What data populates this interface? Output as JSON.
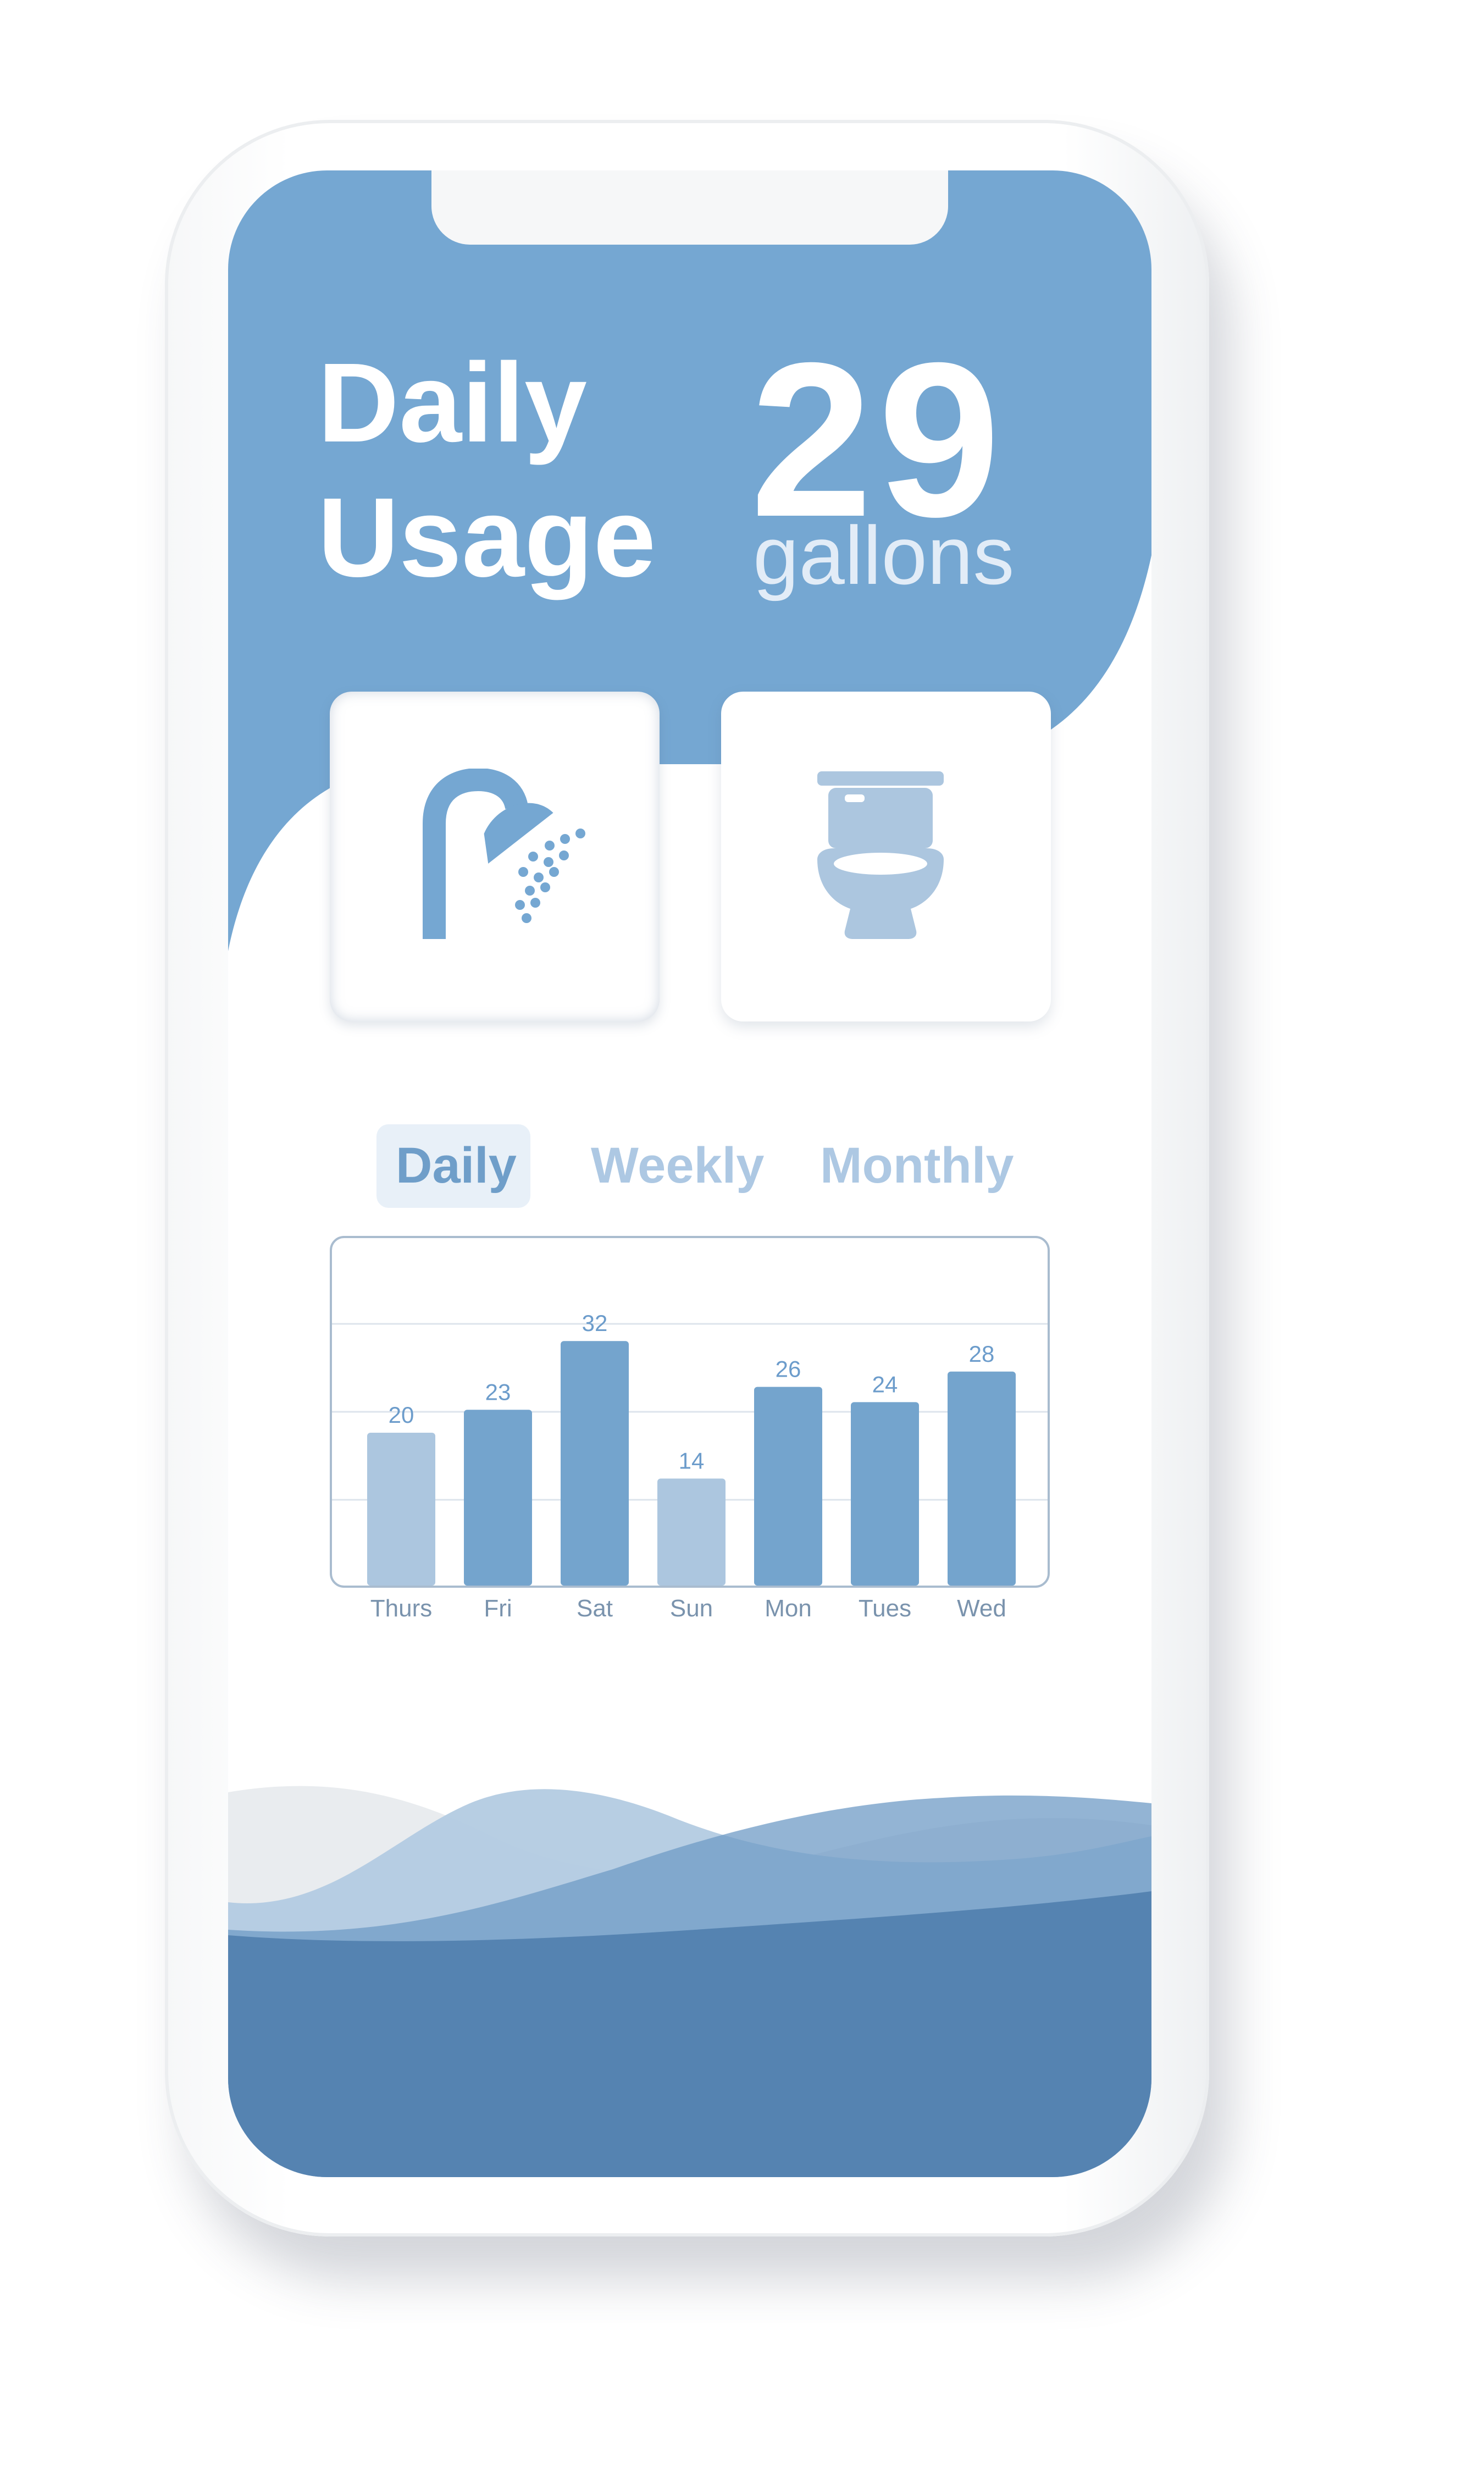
{
  "header": {
    "title_line1": "Daily",
    "title_line2": "Usage",
    "amount": "29",
    "unit": "gallons"
  },
  "cards": [
    {
      "icon": "shower-icon",
      "selected": true
    },
    {
      "icon": "toilet-icon",
      "selected": false
    }
  ],
  "tabs": [
    {
      "label": "Daily",
      "active": true
    },
    {
      "label": "Weekly",
      "active": false
    },
    {
      "label": "Monthly",
      "active": false
    }
  ],
  "colors": {
    "primary": "#75a7d2",
    "bar_dark": "#74a4cd",
    "bar_light": "#acc6df",
    "wave_dark": "#5583b1",
    "tab_active": "#6f9ec9",
    "tab_inactive": "#adc8e3"
  },
  "chart_data": {
    "type": "bar",
    "categories": [
      "Thurs",
      "Fri",
      "Sat",
      "Sun",
      "Mon",
      "Tues",
      "Wed"
    ],
    "values": [
      20,
      23,
      32,
      14,
      26,
      24,
      28
    ],
    "highlight": [
      "light",
      "dark",
      "dark",
      "light",
      "dark",
      "dark",
      "dark"
    ],
    "ylim": [
      0,
      36
    ],
    "grid": true
  }
}
